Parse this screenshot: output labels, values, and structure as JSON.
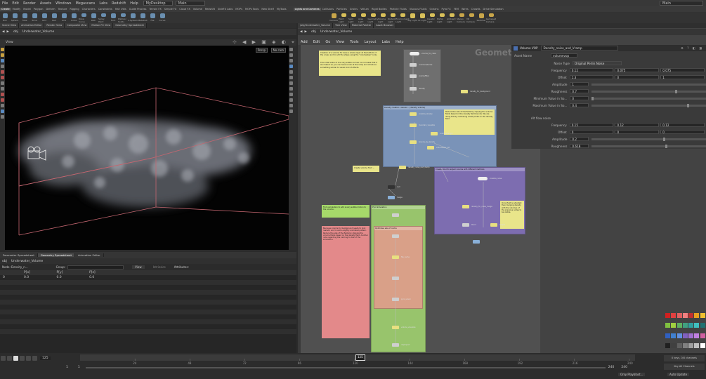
{
  "menu": {
    "items": [
      "File",
      "Edit",
      "Render",
      "Assets",
      "Windows",
      "Megascans",
      "Labs",
      "Redshift",
      "Help"
    ],
    "desktop": "MyDesktop",
    "workspace": "Main"
  },
  "shelf_tabs": [
    "Create",
    "Modify",
    "Model",
    "Polygon",
    "Deform",
    "Texture",
    "Rigging",
    "Characters",
    "Constraints",
    "Hair Utils",
    "Guide Process",
    "Terrain FX",
    "Simple FX",
    "Cloud FX",
    "Volume",
    "Redshift",
    "SideFX Labs",
    "MOPs",
    "MOPs Tools",
    "New Shelf",
    "MyTools"
  ],
  "light_tabs": [
    "Lights and Cameras",
    "Collisions",
    "Particles",
    "Grains",
    "Vellum",
    "Rigid Bodies",
    "Particle Fluids",
    "Viscous Fluids",
    "Oceans",
    "Pyro FX",
    "FEM",
    "Wires",
    "Crowds",
    "Drive Simulation"
  ],
  "shelf_tools": [
    "Box",
    "Sphere",
    "Tube",
    "Torus",
    "Grid",
    "Null",
    "Line",
    "Circle",
    "Draw Curve",
    "Path",
    "Spray Paint",
    "Font",
    "Platonic Solids",
    "L-System",
    "Metaball",
    "File",
    "Curve"
  ],
  "light_tools": [
    "Camera",
    "Point Light",
    "Spot Light",
    "Area Light",
    "Geometry Light",
    "Volume Light",
    "Distant Light",
    "Environment Light",
    "Sky Light",
    "GI Light",
    "Caustic Light",
    "Portal Light",
    "Ambient Light",
    "Stereo Camera",
    "VR Camera",
    "Switcher",
    "Gamepad Camera"
  ],
  "left_path_tabs": [
    "Scene View",
    "Animation Editor",
    "Render View",
    "Composite View",
    "Motion FX View",
    "Geometry Spreadsheet"
  ],
  "right_path_tabs": [
    "/obj/Underwater_Volume",
    "Tree View",
    "Material Palette",
    "Asset Browser"
  ],
  "viewport": {
    "title": "View",
    "path_obj": "obj",
    "path_node": "Underwater_Volume",
    "persp": "Persp",
    "cam": "No cam"
  },
  "spreadsheet": {
    "tabs": [
      "Parameter Spreadsheet",
      "Geometry Spreadsheet",
      "Animation Editor"
    ],
    "node_label": "Node: Density_n...",
    "group_label": "Group:",
    "view_label": "View",
    "intrinsics_label": "Intrinsics",
    "attributes_label": "Attributes:",
    "columns": [
      "",
      "P[x]",
      "P[y]",
      "P[z]"
    ],
    "rows": [
      [
        "0",
        "0.0",
        "0.0",
        "0.0"
      ]
    ]
  },
  "network": {
    "menu": [
      "Add",
      "Edit",
      "Go",
      "View",
      "Tools",
      "Layout",
      "Labs",
      "Help"
    ],
    "path_obj": "obj",
    "path_node": "Underwater_Volume",
    "context_label": "Geometry",
    "box_labels": [
      "Density creation: uses an... (density volume)",
      "Create cloud to adjust volume with different methods",
      "Pyro Simulation",
      "Optimizes size of cache"
    ],
    "note_texts": [
      "Creation of a volume for base a smoke layer at the bottom of the ocean and to add the shape using the \"volumestep\" node.",
      "The initial value of 0 is very subtle and we can increase that if we make it so you can have a look at the ramp and introduce something similar to visual kind of effects.",
      "Reduce the size of the fields by clipping the volume fields based on the density field bounds. We are doing this by combining a few points on the density field.",
      "From simulation to add a very subtle motion to the volume.",
      "Because volume for background needs to look realistic and to add a slightly animated pattern. Reduce the size of the fields by clipping the volume fields based on the density field. Another note regarding the caching to disk of the simulation.",
      "Once field is adjusted: then merging density with the volumes of the previous nodes to be visible.",
      "Create volume from ..."
    ],
    "node_labels": [
      "volume_for_clean",
      "volumerasterize",
      "volumeFilter",
      "density",
      "density_for_background",
      "voxelize_density",
      "mountain_visualize",
      "volumewrangle",
      "bounds_by_density",
      "volumestep_init",
      "voxelize_noise",
      "density_for_noise_merge",
      "blend",
      "merge",
      "density_noise_and_clamp",
      "output",
      "null",
      "file_cache",
      "volume_visualize",
      "pyro_solver",
      "dopimport"
    ]
  },
  "params": {
    "title": "Volume VOP",
    "node_name": "Density_noise_and_Vramp",
    "asset_name_label": "Asset Name",
    "asset_name_value": "volumevop",
    "rows": [
      {
        "label": "Noise Type",
        "values": [
          "Original Perlin Noise"
        ]
      },
      {
        "label": "Frequency",
        "values": [
          "0.12",
          "0.075",
          "0.075"
        ]
      },
      {
        "label": "Offset",
        "values": [
          "1.3",
          "0",
          "1"
        ]
      },
      {
        "label": "Amplitude",
        "values": [
          "1"
        ]
      },
      {
        "label": "Roughness",
        "values": [
          "0.7"
        ]
      },
      {
        "label": "Minimum Value in So...",
        "values": [
          "0"
        ]
      },
      {
        "label": "Maximum Value in So...",
        "values": [
          "0.4"
        ]
      }
    ],
    "section2": "Alt flow noise",
    "rows2": [
      {
        "label": "Frequency",
        "values": [
          "0.15",
          "0.12",
          "0.12"
        ]
      },
      {
        "label": "Offset",
        "values": [
          "0",
          "0",
          "0"
        ]
      },
      {
        "label": "Amplitude",
        "values": [
          "0.2"
        ]
      },
      {
        "label": "Roughness",
        "values": [
          "0.618"
        ]
      }
    ]
  },
  "timeline": {
    "frame": "125",
    "start": "1",
    "start2": "1",
    "end": "240",
    "end2": "240",
    "ticks": [
      "24",
      "48",
      "72",
      "96",
      "120",
      "144",
      "168",
      "192",
      "216",
      "240"
    ],
    "current_marker": "125",
    "keys_label": "0 keys, 0/0 channels",
    "key_all_label": "Key All Channels",
    "auto_update": "Auto Update",
    "only_label": "Only Playblast..."
  },
  "palette_colors": [
    "#d02020",
    "#e04040",
    "#e06060",
    "#f08080",
    "#c03030",
    "#e8a020",
    "#f0c030",
    "#80c040",
    "#a0d040",
    "#60b060",
    "#40a080",
    "#30a0a0",
    "#40c0c0",
    "#207070",
    "#3060c0",
    "#4080d0",
    "#6090e0",
    "#8060c0",
    "#a070d0",
    "#c080e0",
    "#d060a0",
    "#202020",
    "#404040",
    "#606060",
    "#808080",
    "#a0a0a0",
    "#c0c0c0",
    "#ffffff"
  ]
}
